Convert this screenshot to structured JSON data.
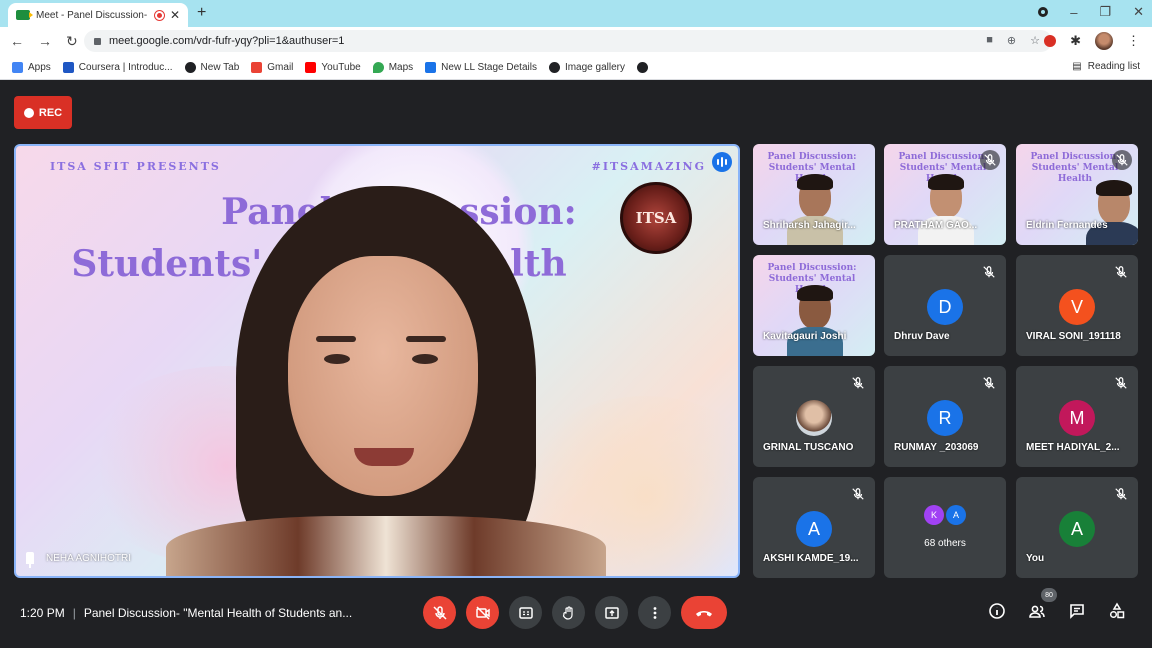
{
  "browser": {
    "tab_title": "Meet - Panel Discussion- \"M",
    "tab_close": "✕",
    "new_tab": "+",
    "url": "meet.google.com/vdr-fufr-yqy?pli=1&authuser=1",
    "bookmarks": [
      {
        "label": "Apps",
        "color": "#4285f4"
      },
      {
        "label": "Coursera | Introduc...",
        "color": "#1f57c3"
      },
      {
        "label": "New Tab",
        "color": "#202124"
      },
      {
        "label": "Gmail",
        "color": "#ea4335"
      },
      {
        "label": "YouTube",
        "color": "#ff0000"
      },
      {
        "label": "Maps",
        "color": "#34a853"
      },
      {
        "label": "New LL Stage Details",
        "color": "#1a73e8"
      },
      {
        "label": "Image gallery",
        "color": "#202124"
      }
    ],
    "reading_list": "Reading list"
  },
  "meet": {
    "rec_label": "REC",
    "main": {
      "presents": "ITSA SFIT PRESENTS",
      "hashtag": "#ITSAMAZING",
      "slide_title_1": "Panel Discussion:",
      "slide_title_2": "Students' Mental Health",
      "logo_text": "ITSA",
      "speaker_name": "NEHA AGNIHOTRI"
    },
    "slide_thumb_title": "Panel Discussion: Students' Mental Health",
    "participants": [
      {
        "name": "Shriharsh Jahagir...",
        "type": "video"
      },
      {
        "name": "PRATHAM GAO...",
        "type": "video"
      },
      {
        "name": "Eldrin Fernandes",
        "type": "video"
      },
      {
        "name": "Kavitagauri Joshi",
        "type": "video"
      },
      {
        "name": "Dhruv Dave",
        "initial": "D",
        "color": "#1a73e8"
      },
      {
        "name": "VIRAL SONI_191118",
        "initial": "V",
        "color": "#f4511e"
      },
      {
        "name": "GRINAL TUSCANO",
        "type": "photo"
      },
      {
        "name": "RUNMAY _203069",
        "initial": "R",
        "color": "#1a73e8"
      },
      {
        "name": "MEET HADIYAL_2...",
        "initial": "M",
        "color": "#c2185b"
      },
      {
        "name": "AKSHI KAMDE_19...",
        "initial": "A",
        "color": "#1a73e8"
      },
      {
        "name": "You",
        "initial": "A",
        "color": "#188038"
      }
    ],
    "others": {
      "label": "68 others",
      "a1": "K",
      "a1_color": "#a142f4",
      "a2": "A",
      "a2_color": "#1a73e8"
    },
    "bottom": {
      "time": "1:20 PM",
      "meeting_title": "Panel Discussion- \"Mental Health of Students an...",
      "participant_count": "80"
    }
  }
}
